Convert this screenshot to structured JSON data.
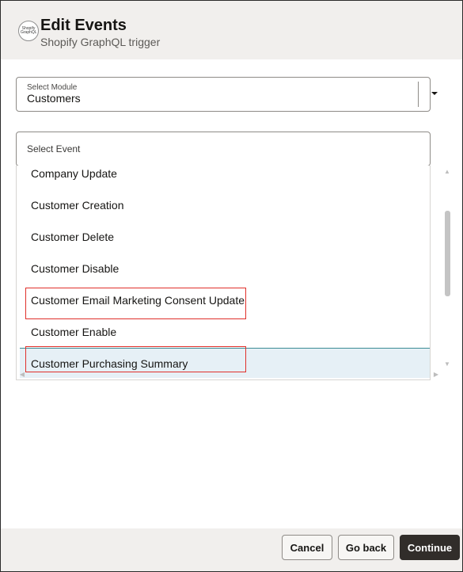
{
  "header": {
    "logo_text": "Shopify GraphQL",
    "title": "Edit Events",
    "subtitle": "Shopify GraphQL trigger"
  },
  "module_select": {
    "label": "Select Module",
    "value": "Customers",
    "caret_icon": "chevron-down-icon"
  },
  "event_select": {
    "placeholder": "Select Event",
    "items": [
      {
        "label": "Company Update"
      },
      {
        "label": "Customer Creation"
      },
      {
        "label": "Customer Delete"
      },
      {
        "label": "Customer Disable"
      },
      {
        "label": "Customer Email Marketing Consent Update",
        "annotated": true
      },
      {
        "label": "Customer Enable"
      },
      {
        "label": "Customer Purchasing Summary",
        "selected": true,
        "annotated": true
      }
    ]
  },
  "footer": {
    "cancel_label": "Cancel",
    "go_back_label": "Go back",
    "continue_label": "Continue"
  },
  "colors": {
    "header_bg": "#f1efed",
    "primary_button": "#312d2a",
    "selected_row": "#e6f0f6",
    "selected_row_border": "#3b8c95",
    "annotation_box": "#e0302b"
  }
}
